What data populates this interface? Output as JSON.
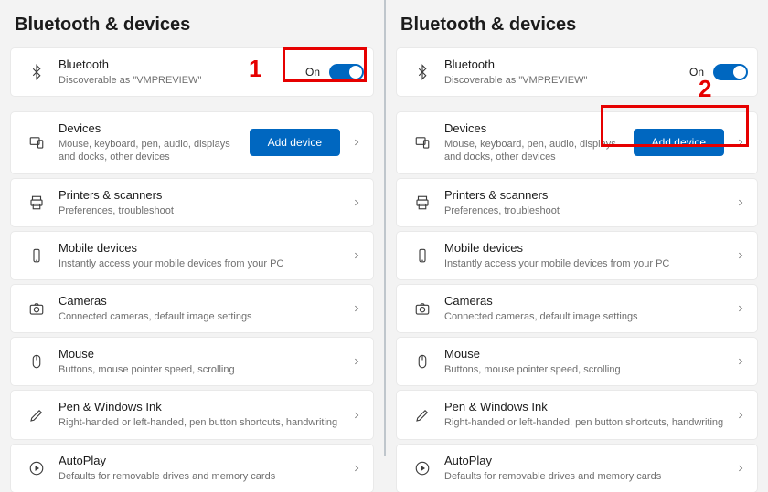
{
  "page_title": "Bluetooth & devices",
  "bluetooth": {
    "title": "Bluetooth",
    "sub": "Discoverable as \"VMPREVIEW\"",
    "state_label": "On"
  },
  "devices": {
    "title": "Devices",
    "sub": "Mouse, keyboard, pen, audio, displays and docks, other devices",
    "add_button": "Add device"
  },
  "items": [
    {
      "title": "Printers & scanners",
      "sub": "Preferences, troubleshoot"
    },
    {
      "title": "Mobile devices",
      "sub": "Instantly access your mobile devices from your PC"
    },
    {
      "title": "Cameras",
      "sub": "Connected cameras, default image settings"
    },
    {
      "title": "Mouse",
      "sub": "Buttons, mouse pointer speed, scrolling"
    },
    {
      "title": "Pen & Windows Ink",
      "sub": "Right-handed or left-handed, pen button shortcuts, handwriting"
    },
    {
      "title": "AutoPlay",
      "sub": "Defaults for removable drives and memory cards"
    }
  ],
  "annotations": {
    "left_number": "1",
    "right_number": "2"
  }
}
